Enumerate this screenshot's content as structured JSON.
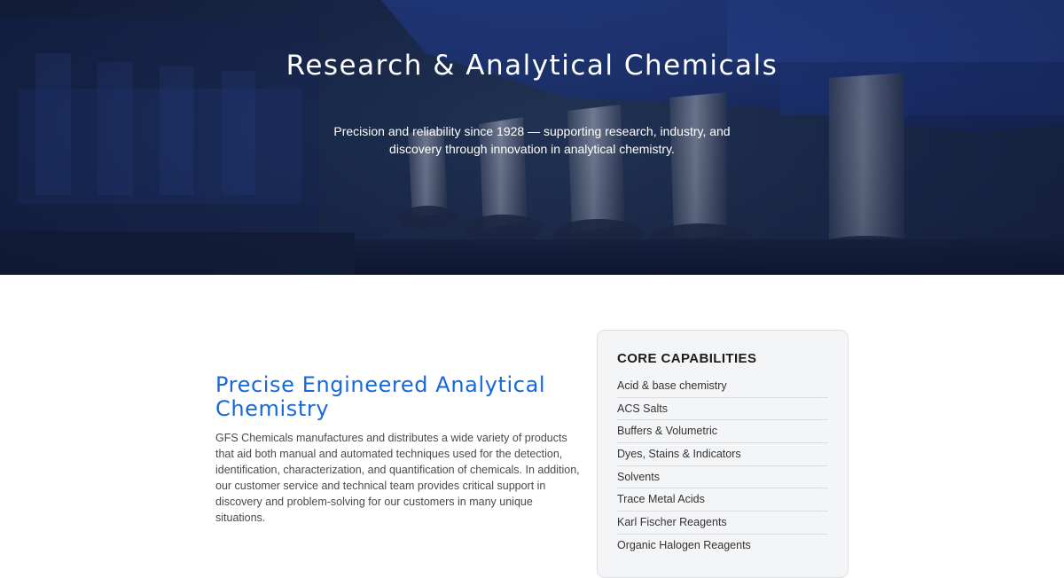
{
  "hero": {
    "title": "Research & Analytical Chemicals",
    "subtitle": "Precision and reliability since 1928 — supporting research, industry, and discovery through innovation in analytical chemistry."
  },
  "intro": {
    "heading": "Precise Engineered Analytical Chemistry",
    "body": "GFS Chemicals manufactures and distributes a wide variety of products that aid both manual and automated techniques used for the detection, identification, characterization, and quantification of chemicals. In addition, our customer service and technical team provides critical support in discovery and problem-solving for our customers in many unique situations."
  },
  "capabilities": {
    "title": "CORE CAPABILITIES",
    "items": [
      "Acid & base chemistry",
      "ACS Salts",
      "Buffers & Volumetric",
      "Dyes, Stains & Indicators",
      "Solvents",
      "Trace Metal Acids",
      "Karl Fischer Reagents",
      "Organic Halogen Reagents"
    ]
  },
  "colors": {
    "accent": "#1868d8",
    "hero_overlay": "#1d2f52",
    "card_bg": "#f4f5f7"
  }
}
